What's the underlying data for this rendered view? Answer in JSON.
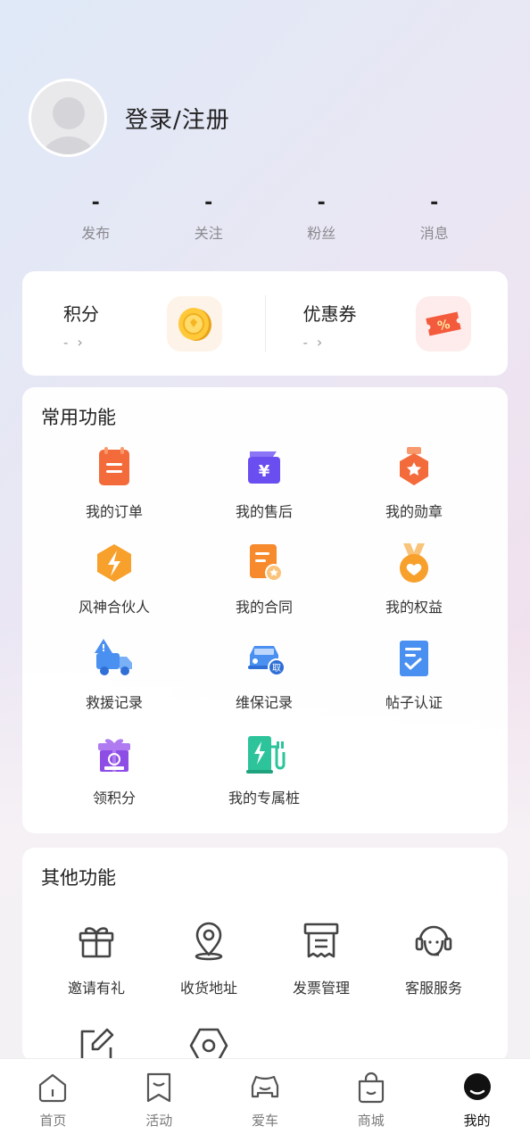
{
  "profile": {
    "login_label": "登录/注册"
  },
  "stats": [
    {
      "value": "-",
      "label": "发布"
    },
    {
      "value": "-",
      "label": "关注"
    },
    {
      "value": "-",
      "label": "粉丝"
    },
    {
      "value": "-",
      "label": "消息"
    }
  ],
  "points": {
    "points_title": "积分",
    "points_value": "-",
    "coupon_title": "优惠券",
    "coupon_value": "-"
  },
  "common": {
    "title": "常用功能",
    "items": [
      {
        "label": "我的订单"
      },
      {
        "label": "我的售后"
      },
      {
        "label": "我的勋章"
      },
      {
        "label": "风神合伙人"
      },
      {
        "label": "我的合同"
      },
      {
        "label": "我的权益"
      },
      {
        "label": "救援记录"
      },
      {
        "label": "维保记录"
      },
      {
        "label": "帖子认证"
      },
      {
        "label": "领积分"
      },
      {
        "label": "我的专属桩"
      }
    ]
  },
  "other": {
    "title": "其他功能",
    "items": [
      {
        "label": "邀请有礼"
      },
      {
        "label": "收货地址"
      },
      {
        "label": "发票管理"
      },
      {
        "label": "客服服务"
      }
    ]
  },
  "tabbar": {
    "items": [
      {
        "label": "首页"
      },
      {
        "label": "活动"
      },
      {
        "label": "爱车"
      },
      {
        "label": "商城"
      },
      {
        "label": "我的"
      }
    ]
  },
  "colors": {
    "accent_orange": "#f46b3b",
    "accent_purple": "#6b4ef0",
    "accent_blue": "#3d8bf0",
    "accent_green": "#2ec49b"
  }
}
